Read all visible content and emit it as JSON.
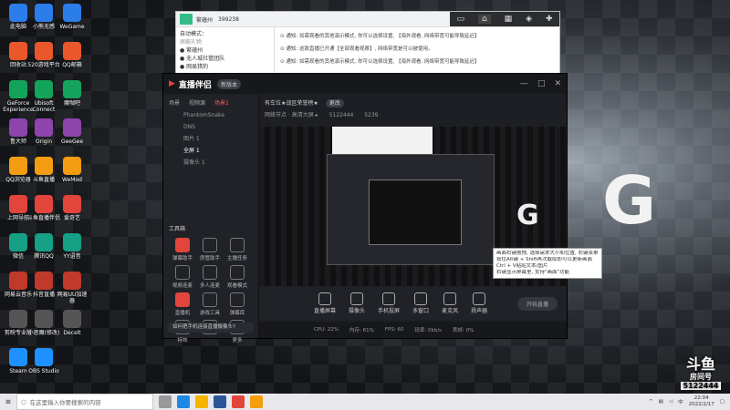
{
  "desktop": {
    "icons_col1": [
      "此电脑",
      "回收站",
      "GeForce Experience",
      "鲁大师",
      "QQ浏览器",
      "上网导航",
      "微信",
      "网易云音乐",
      "剪映专业版",
      "Steam"
    ],
    "icons_col2": [
      "小熊无感",
      "520游戏平台",
      "Ubisoft Connect",
      "Origin",
      "斗鱼直播",
      "斗鱼直播伴侣",
      "腾讯QQ",
      "抖音直播",
      "小恶魔(修改)",
      "OBS Studio"
    ],
    "icons_col3": [
      "WeGame",
      "QQ邮箱",
      "魔咖吧",
      "GeeGee",
      "WeMod",
      "爱奇艺",
      "YY语音",
      "网易UU加速器",
      "Decelt"
    ]
  },
  "chatwin": {
    "user": "繁蕴州",
    "fans": "399238",
    "mode": "自动模式：",
    "filter": "屏蔽礼物",
    "list": [
      "繁蕴州",
      "无人城社管团队",
      "网易猎豹"
    ],
    "notices": [
      "通知: 如需观看的其他演示模式, 你可以选择设置, 【海外观看, 网络带宽可能导致延迟】",
      "通知: 这款直播已开通【全部观看观察】, 网络带宽是可以被使用。",
      "通知: 如需观看的其他演示模式, 你可以选择设置, 【海外观看, 网络带宽可能导致延迟】"
    ]
  },
  "app": {
    "title": "直播伴侣",
    "badge": "新版本",
    "tabs": [
      "场景",
      "视频源",
      "场景1"
    ],
    "scenes": [
      "PhantomSnake",
      "DNS",
      "图片 1",
      "全屏 1",
      "摄像头 1"
    ],
    "room_title": "有车位★战区荣誉榜★",
    "room_tag": "更改",
    "room_sub": "网络节点 · 高清大屏 ▸",
    "viewers": "5122444",
    "likes": "5239",
    "tools_title": "工具箱",
    "tools": [
      "弹幕助手",
      "房管助手",
      "主播任务",
      "视频连麦",
      "多人连麦",
      "观看模式",
      "直播机",
      "游戏工具",
      "弹幕库",
      "特效",
      "",
      "更多"
    ],
    "tip": "如何把手机连接直播摄像头?",
    "controls": [
      "直播屏幕",
      "摄像头",
      "手机投屏",
      "多窗口",
      "麦克风",
      "扬声器"
    ],
    "start": "开始直播",
    "status": [
      "CPU: 22%",
      "内存: 61%",
      "FPS: 60",
      "码率: 0kb/s",
      "丢帧: 0%"
    ]
  },
  "hint": {
    "lines": [
      "画面右键拖拽, 选择需求大小和位置, 右键菜单弹出层",
      "按住Alt键 + Shift再次截取即可以更新画面",
      "Ctrl + V粘贴文本/图片",
      "右键显示屏幕里, 支持\"画面\"功能"
    ]
  },
  "watermark": {
    "brand": "斗鱼",
    "room": "房间号",
    "num": "5122444"
  },
  "taskbar": {
    "search_placeholder": "在这里输入你要搜索的内容",
    "time": "22:04",
    "date": "2022/2/17",
    "lang": "中"
  },
  "colors": {
    "accent": "#e2453b",
    "app_bg": "#1d1f24",
    "taskbar": "#e8e8ec"
  }
}
